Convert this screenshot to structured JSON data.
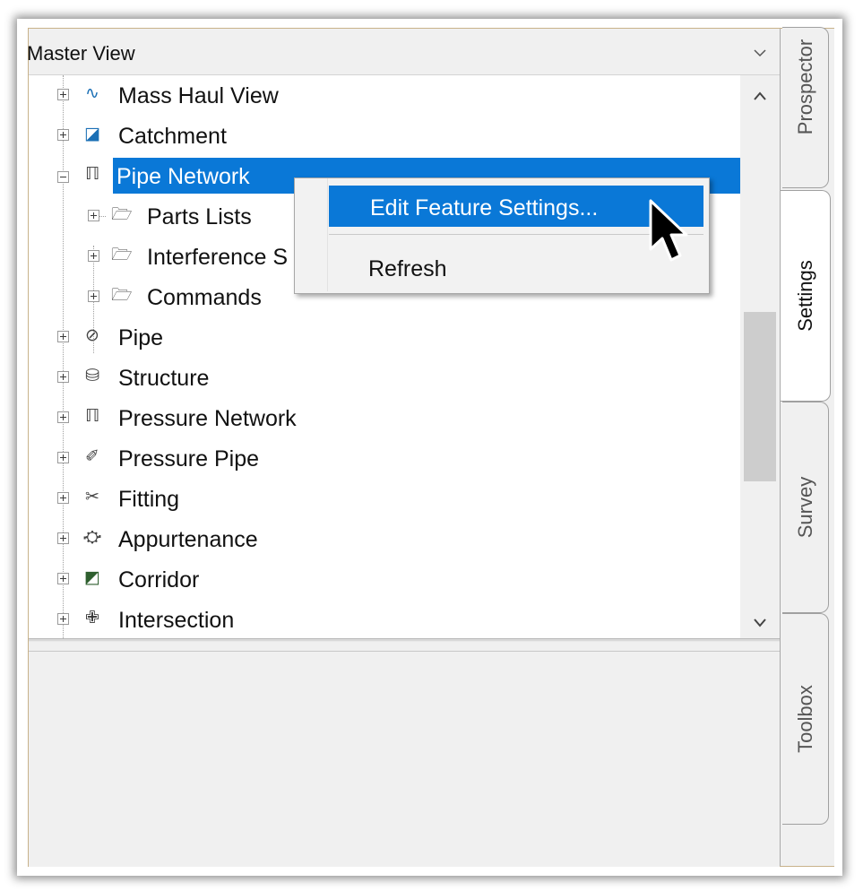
{
  "panel": {
    "view_selector": {
      "value": "Master View"
    }
  },
  "tree": {
    "items": [
      {
        "label": "Mass Haul View",
        "icon": "mass-haul-view-icon",
        "glyph": "∿",
        "expander": "plus",
        "level": 0
      },
      {
        "label": "Catchment",
        "icon": "catchment-icon",
        "glyph": "◪",
        "expander": "plus",
        "level": 0
      },
      {
        "label": "Pipe Network",
        "icon": "pipe-network-icon",
        "glyph": "ℿ",
        "expander": "minus",
        "level": 0,
        "selected": true
      },
      {
        "label": "Parts Lists",
        "icon": "folder-open-icon",
        "glyph": "🗁",
        "expander": "plus",
        "level": 1
      },
      {
        "label": "Interference S",
        "icon": "folder-open-icon",
        "glyph": "🗁",
        "expander": "plus",
        "level": 1
      },
      {
        "label": "Commands",
        "icon": "folder-open-icon",
        "glyph": "🗁",
        "expander": "plus",
        "level": 1
      },
      {
        "label": "Pipe",
        "icon": "pipe-icon",
        "glyph": "⊘",
        "expander": "plus",
        "level": 0
      },
      {
        "label": "Structure",
        "icon": "structure-icon",
        "glyph": "⛁",
        "expander": "plus",
        "level": 0
      },
      {
        "label": "Pressure Network",
        "icon": "pressure-network-icon",
        "glyph": "ℿ",
        "expander": "plus",
        "level": 0
      },
      {
        "label": "Pressure Pipe",
        "icon": "pressure-pipe-icon",
        "glyph": "✐",
        "expander": "plus",
        "level": 0
      },
      {
        "label": "Fitting",
        "icon": "fitting-icon",
        "glyph": "✂",
        "expander": "plus",
        "level": 0
      },
      {
        "label": "Appurtenance",
        "icon": "appurtenance-icon",
        "glyph": "⛮",
        "expander": "plus",
        "level": 0
      },
      {
        "label": "Corridor",
        "icon": "corridor-icon",
        "glyph": "◩",
        "expander": "plus",
        "level": 0
      },
      {
        "label": "Intersection",
        "icon": "intersection-icon",
        "glyph": "✙",
        "expander": "plus",
        "level": 0
      }
    ]
  },
  "context_menu": {
    "items": [
      {
        "label": "Edit Feature Settings...",
        "highlighted": true
      },
      {
        "label": "Refresh",
        "highlighted": false
      }
    ]
  },
  "side_tabs": [
    {
      "label": "Prospector",
      "active": false
    },
    {
      "label": "Settings",
      "active": true
    },
    {
      "label": "Survey",
      "active": false
    },
    {
      "label": "Toolbox",
      "active": false
    }
  ],
  "colors": {
    "selection": "#0a78d7",
    "panel_background": "#f0f0f0",
    "frame_border": "#c8b28a"
  }
}
